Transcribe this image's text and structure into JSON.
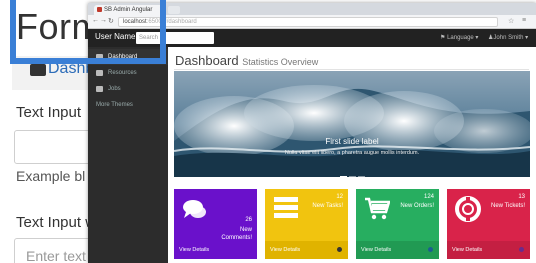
{
  "background_page": {
    "title": "Forms",
    "crumb": "Dashb",
    "text_input_label": "Text Input",
    "help_text": "Example bl",
    "text_input_with_label": "Text Input w",
    "placeholder": "Enter text"
  },
  "browser": {
    "tab_title": "SB Admin Angular",
    "url_host": "localhost",
    "url_path": ":6500/#/dashboard"
  },
  "topnav": {
    "brand": "User Name",
    "search_placeholder": "Search",
    "language": "Language",
    "user": "John Smith"
  },
  "sidebar": {
    "items": [
      {
        "label": "Dashboard",
        "active": true
      },
      {
        "label": "Resources",
        "active": false
      },
      {
        "label": "Jobs",
        "active": false
      },
      {
        "label": "More Themes",
        "active": false
      }
    ]
  },
  "main": {
    "title": "Dashboard",
    "subtitle": "Statistics Overview",
    "carousel": {
      "caption_title": "First slide label",
      "caption_text": "Nulla vitae elit libero, a pharetra augue mollis interdum."
    },
    "panels": [
      {
        "count": "26",
        "label": "New Comments!",
        "footer": "View Details",
        "color": "#6a11cb",
        "foot_color": "#5a0fb0"
      },
      {
        "count": "12",
        "label": "New Tasks!",
        "footer": "View Details",
        "color": "#f1c40f",
        "foot_color": "#e0b300"
      },
      {
        "count": "124",
        "label": "New Orders!",
        "footer": "View Details",
        "color": "#27ae60",
        "foot_color": "#219a53"
      },
      {
        "count": "13",
        "label": "New Tickets!",
        "footer": "View Details",
        "color": "#d9234a",
        "foot_color": "#c41f42"
      }
    ]
  },
  "colors": {
    "highlight_frame": "#3a7fd6",
    "sidebar_bg": "#2c2c2c",
    "topnav_bg": "#222222"
  }
}
